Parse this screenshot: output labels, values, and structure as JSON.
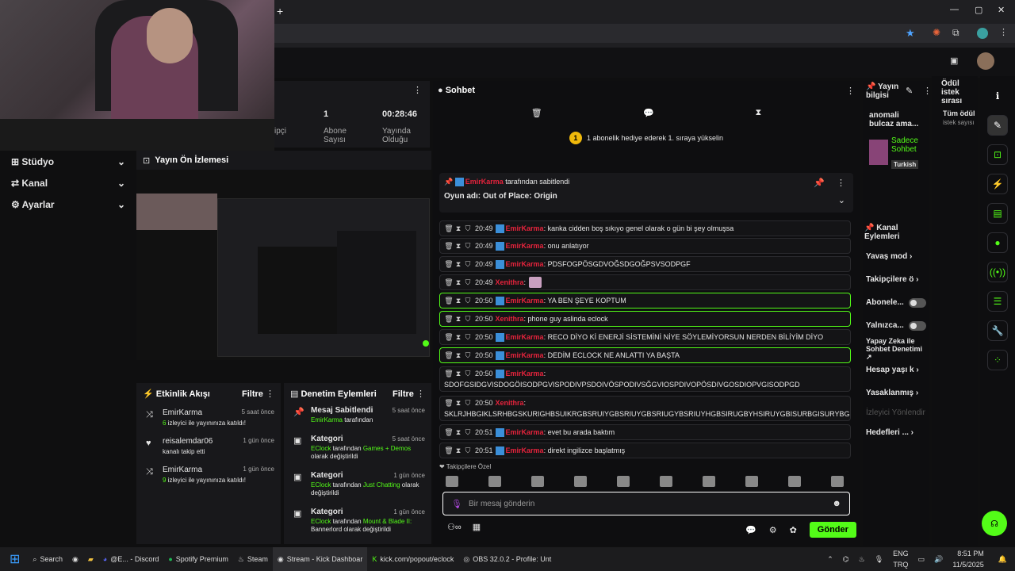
{
  "browser": {
    "plus": "+",
    "min": "—",
    "max": "▢",
    "close": "✕"
  },
  "appbar": {},
  "nav": [
    {
      "label": "Stüdyo",
      "icon": "studio-icon"
    },
    {
      "label": "Kanal",
      "icon": "channel-icon"
    },
    {
      "label": "Ayarlar",
      "icon": "gear-icon"
    }
  ],
  "stats": {
    "col1": "ipçi",
    "sub_count": "1",
    "sub_label": "Abone Sayısı",
    "stream_time": "00:28:46",
    "stream_label": "Yayında Olduğu"
  },
  "preview": {
    "title": "Yayın Ön İzlemesi"
  },
  "activity": {
    "title": "Etkinlik Akışı",
    "filter": "Filtre",
    "items": [
      {
        "name": "EmirKarma",
        "time": "5 saat önce",
        "count": "6",
        "text": " izleyici ile yayınınıza katıldı!"
      },
      {
        "name": "reisalemdar06",
        "time": "1 gün önce",
        "count": "",
        "text": "kanalı takip etti"
      },
      {
        "name": "EmirKarma",
        "time": "1 gün önce",
        "count": "9",
        "text": " izleyici ile yayınınıza katıldı!"
      }
    ]
  },
  "moderation": {
    "title": "Denetim Eylemleri",
    "filter": "Filtre",
    "items": [
      {
        "title": "Mesaj Sabitlendi",
        "time": "5 saat önce",
        "user": "EmirKarma",
        "mid": " tarafından",
        "target": "",
        "tail": ""
      },
      {
        "title": "Kategori",
        "time": "5 saat önce",
        "user": "EClock",
        "mid": " tarafından ",
        "target": "Games + Demos",
        "tail": "olarak değiştirildi"
      },
      {
        "title": "Kategori",
        "time": "1 gün önce",
        "user": "EClock",
        "mid": " tarafından ",
        "target": "Just Chatting",
        "tail": "olarak değiştirildi"
      },
      {
        "title": "Kategori",
        "time": "1 gün önce",
        "user": "EClock",
        "mid": " tarafından ",
        "target": "Mount & Blade II:",
        "tail": "Bannerlord olarak değiştirildi"
      }
    ]
  },
  "chat": {
    "title": "Sohbet",
    "gift": "1 abonelik hediye ederek 1. sıraya yükselin",
    "pinned_by": "EmirKarma",
    "pinned_suffix": " tarafından sabitlendi",
    "pinned_text": "Oyun adı: Out of Place: Origin",
    "messages": [
      {
        "time": "20:49",
        "user": "EmirKarma",
        "text": ": kanka cidden boş sıkıyo genel olarak o gün bi şey olmuşsa",
        "hl": false
      },
      {
        "time": "20:49",
        "user": "EmirKarma",
        "text": ": onu anlatıyor",
        "hl": false
      },
      {
        "time": "20:49",
        "user": "EmirKarma",
        "text": ": PDSFOGPÖSGDVOĞSDGOĞPSVSODPGF",
        "hl": false
      },
      {
        "time": "20:49",
        "user": "Xenithra",
        "text": ":",
        "hl": false
      },
      {
        "time": "20:50",
        "user": "EmirKarma",
        "text": ": YA BEN ŞEYE KOPTUM",
        "hl": true
      },
      {
        "time": "20:50",
        "user": "Xenithra",
        "text": ": phone guy aslinda eclock",
        "hl": true
      },
      {
        "time": "20:50",
        "user": "EmirKarma",
        "text": ": RECO DİYO Kİ ENERJİ SİSTEMİNİ NİYE SÖYLEMİYORSUN NERDEN BİLİYİM DİYO",
        "hl": false
      },
      {
        "time": "20:50",
        "user": "EmirKarma",
        "text": ": DEDİM ECLOCK NE ANLATTI YA BAŞTA",
        "hl": true
      }
    ],
    "long1_time": "20:50",
    "long1_user": "EmirKarma",
    "long1_text": "SDOFGSIDGVISDOGÖISODPGVISPODIVPSDOIVÖSPODIVSĞGVIOSPDIVOPÖSDIVGOSDIOPVGISODPGD",
    "long2_time": "20:50",
    "long2_user": "Xenithra",
    "long2_text": "SKLRJHBGIKLSRHBGSKURIGHBSUIKRGBSRUIYGBSRIUYGBSRIUGYBSRIUYHGBSIRUGBYHSIRUYGBISURBGISURYBGSURBG",
    "last": [
      {
        "time": "20:51",
        "user": "EmirKarma",
        "text": ": evet bu arada baktım"
      },
      {
        "time": "20:51",
        "user": "EmirKarma",
        "text": ": direkt ingilizce başlatmış"
      }
    ],
    "follower_label": "❤ Takipçilere Özel",
    "input_placeholder": "Bir mesaj gönderin",
    "send": "Gönder"
  },
  "stream_info": {
    "title": "Yayın bilgisi",
    "desc": "anomali bulcaz ama...",
    "tag1": "Sadece Sohbet",
    "tag2": "Turkish"
  },
  "queue": {
    "title": "Ödül istek sırası",
    "all": "Tüm ödül",
    "sub": "istek sayısı"
  },
  "channel_actions": {
    "title": "Kanal Eylemleri",
    "items": [
      "Yavaş mod",
      "Takipçilere ö",
      "Abonele...",
      "Yalnızca...",
      "Yapay Zeka ile Sohbet Denetimi",
      "Hesap yaşı k",
      "Yasaklanmış",
      "İzleyici Yönlendir",
      "Hedefleri ..."
    ]
  },
  "taskbar": {
    "search": "Search",
    "items": [
      "@E... - Discord",
      "Spotify Premium",
      "Steam",
      "Stream - Kick Dashboar",
      "kick.com/popout/eclock",
      "OBS 32.0.2 - Profile: Unt"
    ],
    "lang": "ENG",
    "region": "TRQ",
    "time": "8:51 PM",
    "date": "11/5/2025"
  }
}
